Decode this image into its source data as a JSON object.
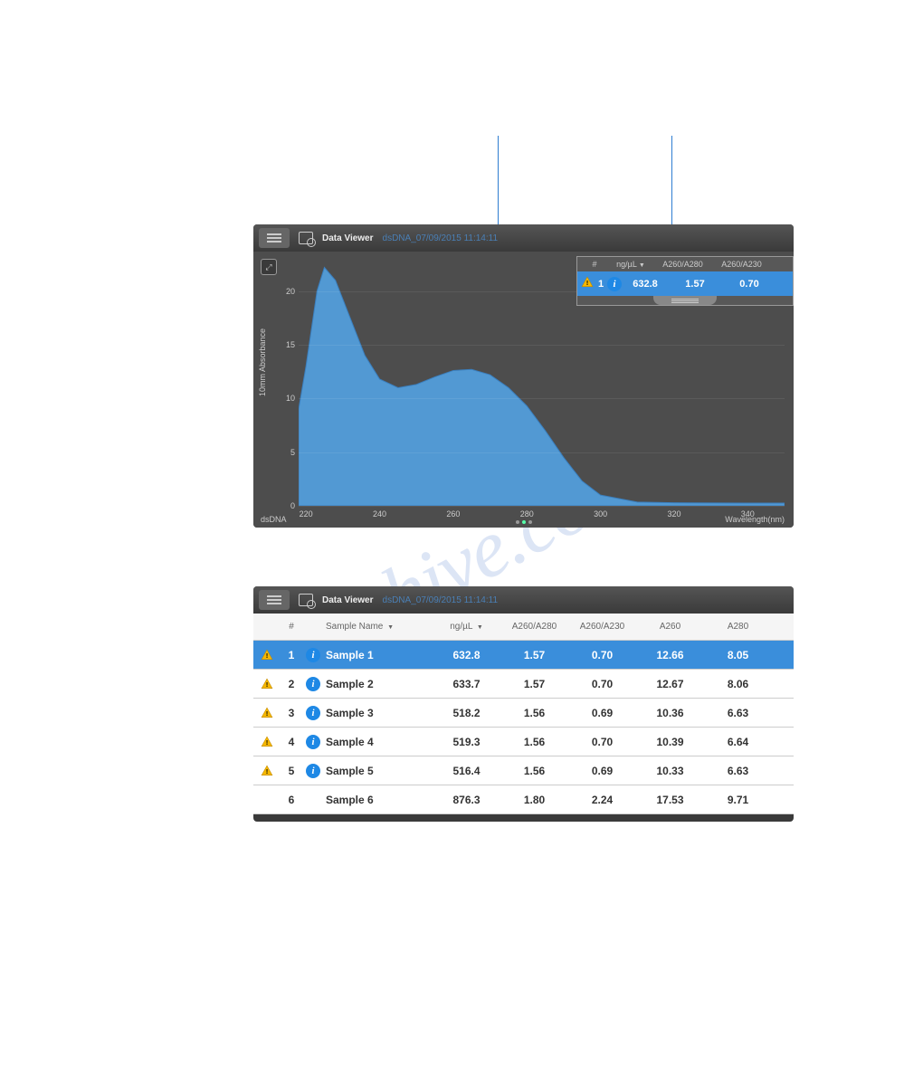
{
  "watermark": "shive.com",
  "toolbar": {
    "title": "Data Viewer",
    "filename": "dsDNA_07/09/2015 11:14:11"
  },
  "chart_data": {
    "type": "area",
    "title": "",
    "xlabel": "Wavelength(nm)",
    "ylabel": "10mm Absorbance",
    "corner_label": "dsDNA",
    "xlim": [
      218,
      350
    ],
    "ylim": [
      0,
      23
    ],
    "xticks": [
      220,
      240,
      260,
      280,
      300,
      320,
      340
    ],
    "yticks": [
      0,
      5,
      10,
      15,
      20
    ],
    "series": [
      {
        "name": "Sample 1",
        "x": [
          218,
          220,
          223,
          225,
          228,
          232,
          236,
          240,
          245,
          250,
          255,
          260,
          265,
          270,
          275,
          280,
          285,
          290,
          295,
          300,
          310,
          320,
          340,
          350
        ],
        "values": [
          9,
          13,
          20,
          22.2,
          21,
          17.5,
          14,
          11.8,
          11,
          11.3,
          12,
          12.6,
          12.7,
          12.2,
          11,
          9.3,
          7.0,
          4.5,
          2.3,
          1.0,
          0.35,
          0.28,
          0.25,
          0.25
        ]
      }
    ]
  },
  "overlay": {
    "headers": {
      "num": "#",
      "ng": "ng/µL",
      "r1": "A260/A280",
      "r2": "A260/A230",
      "drop": "▼"
    },
    "row": {
      "num": "1",
      "ng": "632.8",
      "r1": "1.57",
      "r2": "0.70"
    }
  },
  "table": {
    "headers": {
      "num": "#",
      "name": "Sample Name",
      "ng": "ng/µL",
      "r1": "A260/A280",
      "r2": "A260/A230",
      "a260": "A260",
      "a280": "A280",
      "drop": "▼"
    },
    "rows": [
      {
        "warn": true,
        "info": true,
        "num": "1",
        "name": "Sample 1",
        "ng": "632.8",
        "r1": "1.57",
        "r2": "0.70",
        "a260": "12.66",
        "a280": "8.05",
        "selected": true
      },
      {
        "warn": true,
        "info": true,
        "num": "2",
        "name": "Sample 2",
        "ng": "633.7",
        "r1": "1.57",
        "r2": "0.70",
        "a260": "12.67",
        "a280": "8.06",
        "selected": false
      },
      {
        "warn": true,
        "info": true,
        "num": "3",
        "name": "Sample 3",
        "ng": "518.2",
        "r1": "1.56",
        "r2": "0.69",
        "a260": "10.36",
        "a280": "6.63",
        "selected": false
      },
      {
        "warn": true,
        "info": true,
        "num": "4",
        "name": "Sample 4",
        "ng": "519.3",
        "r1": "1.56",
        "r2": "0.70",
        "a260": "10.39",
        "a280": "6.64",
        "selected": false
      },
      {
        "warn": true,
        "info": true,
        "num": "5",
        "name": "Sample 5",
        "ng": "516.4",
        "r1": "1.56",
        "r2": "0.69",
        "a260": "10.33",
        "a280": "6.63",
        "selected": false
      },
      {
        "warn": false,
        "info": false,
        "num": "6",
        "name": "Sample 6",
        "ng": "876.3",
        "r1": "1.80",
        "r2": "2.24",
        "a260": "17.53",
        "a280": "9.71",
        "selected": false
      }
    ]
  }
}
